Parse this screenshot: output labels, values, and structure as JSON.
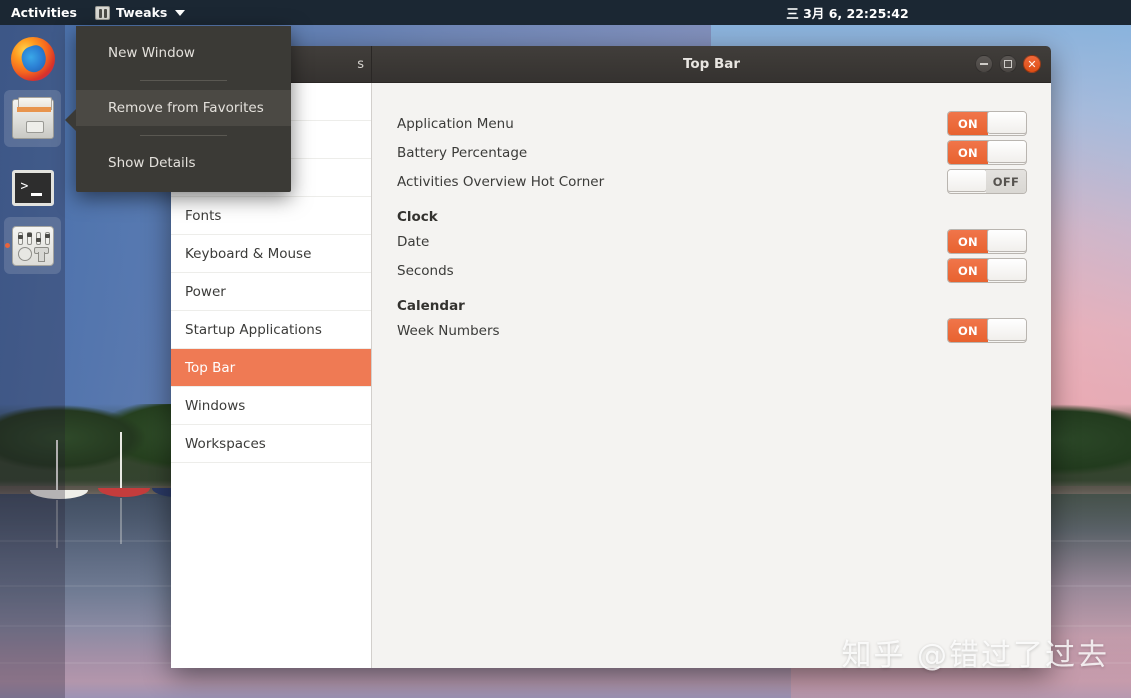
{
  "topbar": {
    "activities_label": "Activities",
    "app_name": "Tweaks",
    "app_icon": "tweaks-icon",
    "caret_icon": "chevron-down-icon",
    "clock": "三 3月  6, 22:25:42"
  },
  "dock": {
    "items": [
      {
        "name": "firefox",
        "label": "Firefox Web Browser",
        "running": false,
        "favorited": true
      },
      {
        "name": "files",
        "label": "Files",
        "running": false,
        "favorited": true
      },
      {
        "name": "terminal",
        "label": "Terminal",
        "running": false,
        "favorited": true
      },
      {
        "name": "tweaks",
        "label": "Tweaks",
        "running": true,
        "favorited": true
      }
    ]
  },
  "context_menu": {
    "items": [
      {
        "label": "New Window",
        "highlighted": false
      },
      {
        "separator": true
      },
      {
        "label": "Remove from Favorites",
        "highlighted": true
      },
      {
        "separator": true
      },
      {
        "label": "Show Details",
        "highlighted": false
      }
    ]
  },
  "window": {
    "title": "Top Bar",
    "header_left_text": "s",
    "buttons": {
      "minimize": "minimize-icon",
      "maximize": "maximize-icon",
      "close": "close-icon"
    }
  },
  "sidebar": {
    "items": [
      {
        "label": "",
        "selected": false
      },
      {
        "label": "",
        "selected": false
      },
      {
        "label": "",
        "selected": false
      },
      {
        "label": "Fonts",
        "selected": false
      },
      {
        "label": "Keyboard & Mouse",
        "selected": false
      },
      {
        "label": "Power",
        "selected": false
      },
      {
        "label": "Startup Applications",
        "selected": false
      },
      {
        "label": "Top Bar",
        "selected": true
      },
      {
        "label": "Windows",
        "selected": false
      },
      {
        "label": "Workspaces",
        "selected": false
      }
    ]
  },
  "content": {
    "rows": [
      {
        "label": "Application Menu",
        "state": "ON"
      },
      {
        "label": "Battery Percentage",
        "state": "ON"
      },
      {
        "label": "Activities Overview Hot Corner",
        "state": "OFF"
      }
    ],
    "clock_section": {
      "heading": "Clock",
      "rows": [
        {
          "label": "Date",
          "state": "ON"
        },
        {
          "label": "Seconds",
          "state": "ON"
        }
      ]
    },
    "calendar_section": {
      "heading": "Calendar",
      "rows": [
        {
          "label": "Week Numbers",
          "state": "ON"
        }
      ]
    }
  },
  "watermark": "知乎 @错过了过去",
  "colors": {
    "accent_orange": "#ef7a54",
    "toggle_on": "#e8622f",
    "topbar_bg": "#1b2733",
    "menu_bg": "#3b3a36",
    "titlebar_bg": "#3b3835"
  }
}
